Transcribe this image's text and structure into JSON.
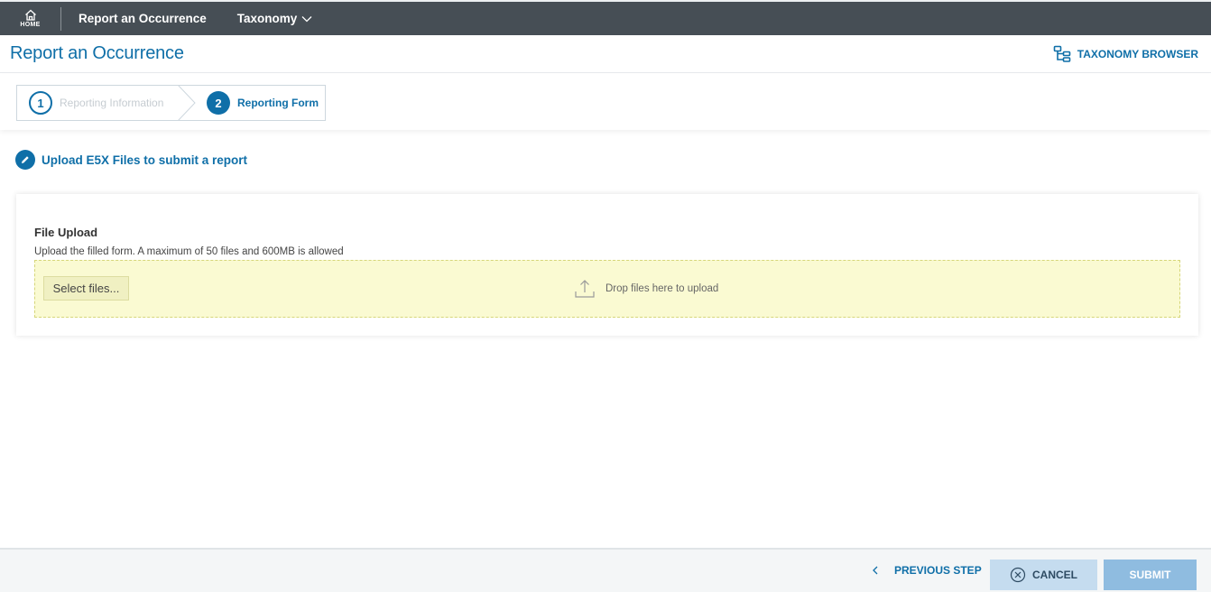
{
  "topbar": {
    "home_label": "HOME",
    "nav_report": "Report an Occurrence",
    "nav_taxonomy": "Taxonomy"
  },
  "header": {
    "title": "Report an Occurrence",
    "taxonomy_browser": "TAXONOMY BROWSER"
  },
  "steps": [
    {
      "number": "1",
      "label": "Reporting Information",
      "state": "completed"
    },
    {
      "number": "2",
      "label": "Reporting Form",
      "state": "active"
    }
  ],
  "section": {
    "title": "Upload E5X Files to submit a report"
  },
  "upload": {
    "title": "File Upload",
    "description": "Upload the filled form. A maximum of 50 files and 600MB is allowed",
    "select_label": "Select files...",
    "drop_hint": "Drop files here to upload"
  },
  "footer": {
    "previous": "PREVIOUS STEP",
    "cancel": "CANCEL",
    "submit": "SUBMIT"
  },
  "colors": {
    "topbar": "#464e55",
    "accent": "#0f6fa8",
    "dropzone": "#fafad2",
    "cancel_bg": "#c5dcef",
    "submit_bg": "#8fbce0"
  }
}
